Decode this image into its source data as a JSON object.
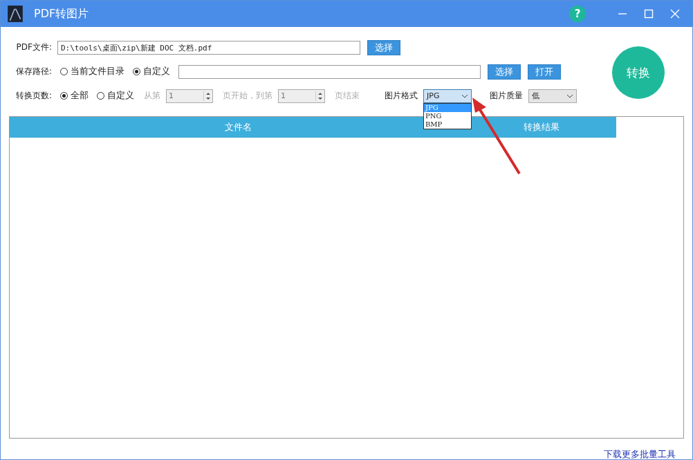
{
  "window": {
    "title": "PDF转图片",
    "help": "?"
  },
  "pdf_file": {
    "label": "PDF文件:",
    "value": "D:\\tools\\桌面\\zip\\新建 DOC 文档.pdf",
    "button": "选择"
  },
  "save_path": {
    "label": "保存路径:",
    "options": [
      {
        "label": "当前文件目录",
        "selected": false
      },
      {
        "label": "自定义",
        "selected": true
      }
    ],
    "buttons": [
      "选择",
      "打开"
    ]
  },
  "pages": {
    "label": "转换页数:",
    "options": [
      {
        "label": "全部",
        "selected": true
      },
      {
        "label": "自定义",
        "selected": false
      }
    ],
    "disabled": true,
    "from_label": "从第",
    "from_value": "1",
    "mid_label": "页开始，到第",
    "to_value": "1",
    "end_label": "页结束"
  },
  "image_format": {
    "label": "图片格式",
    "value": "JPG",
    "expanded": true,
    "options": [
      {
        "label": "JPG",
        "selected": true
      },
      {
        "label": "PNG",
        "selected": false
      },
      {
        "label": "BMP",
        "selected": false
      }
    ]
  },
  "image_quality": {
    "label": "图片质量",
    "value": "低"
  },
  "convert_button": "转换",
  "table": {
    "columns": [
      "文件名",
      "转换结果"
    ]
  },
  "footer_link": "下载更多批量工具"
}
